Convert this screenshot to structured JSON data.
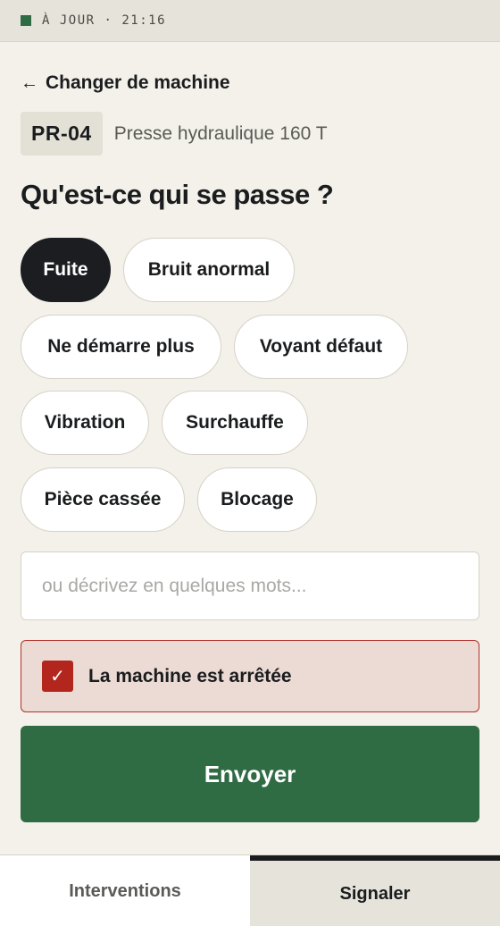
{
  "status": {
    "text": "À JOUR · 21:16",
    "color": "#2f6b43"
  },
  "back": {
    "arrow": "←",
    "label": "Changer de machine"
  },
  "machine": {
    "code": "PR-04",
    "name": "Presse hydraulique 160 T"
  },
  "question": "Qu'est-ce qui se passe ?",
  "issues": [
    {
      "label": "Fuite",
      "selected": true
    },
    {
      "label": "Bruit anormal",
      "selected": false
    },
    {
      "label": "Ne démarre plus",
      "selected": false
    },
    {
      "label": "Voyant défaut",
      "selected": false
    },
    {
      "label": "Vibration",
      "selected": false
    },
    {
      "label": "Surchauffe",
      "selected": false
    },
    {
      "label": "Pièce cassée",
      "selected": false
    },
    {
      "label": "Blocage",
      "selected": false
    }
  ],
  "description": {
    "value": "",
    "placeholder": "ou décrivez en quelques mots..."
  },
  "stopped": {
    "checked": true,
    "checkmark": "✓",
    "label": "La machine est arrêtée",
    "color": "#b3261e"
  },
  "submit": {
    "label": "Envoyer",
    "color": "#2f6b43"
  },
  "nav": {
    "tabs": [
      {
        "label": "Interventions",
        "active": false
      },
      {
        "label": "Signaler",
        "active": true
      }
    ]
  }
}
